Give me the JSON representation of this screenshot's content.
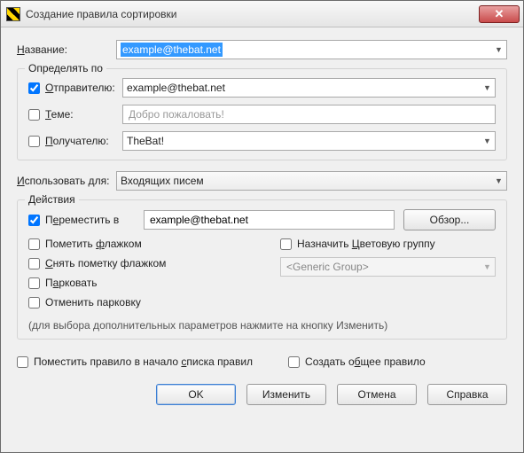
{
  "title": "Создание правила сортировки",
  "name_label": "Название:",
  "name_value": "example@thebat.net",
  "detect_legend": "Определять по",
  "sender": {
    "label": "Отправителю:",
    "checked": true,
    "value": "example@thebat.net"
  },
  "subject": {
    "label": "Теме:",
    "checked": false,
    "placeholder": "Добро пожаловать!"
  },
  "recipient": {
    "label": "Получателю:",
    "checked": false,
    "value": "TheBat!"
  },
  "use_for_label": "Использовать для:",
  "use_for_value": "Входящих писем",
  "actions_legend": "Действия",
  "move": {
    "label": "Переместить в",
    "checked": true,
    "value": "example@thebat.net",
    "browse": "Обзор..."
  },
  "flags": {
    "mark_flag": "Пометить флажком",
    "clear_flag": "Снять пометку флажком",
    "park": "Парковать",
    "unpark": "Отменить парковку",
    "assign_color": "Назначить Цветовую группу",
    "color_group_value": "<Generic Group>"
  },
  "hint": "(для выбора дополнительных параметров нажмите на кнопку Изменить)",
  "bottom": {
    "to_top": "Поместить правило в начало списка правил",
    "common": "Создать общее правило"
  },
  "buttons": {
    "ok": "OK",
    "edit": "Изменить",
    "cancel": "Отмена",
    "help": "Справка"
  }
}
